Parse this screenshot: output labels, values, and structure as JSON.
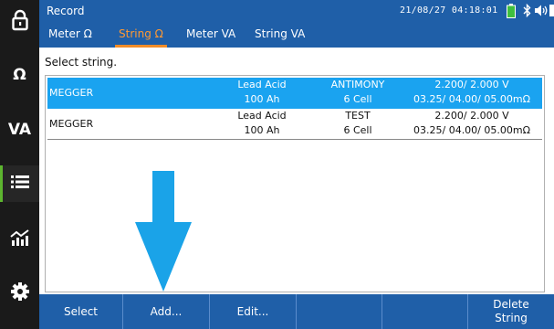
{
  "sidebar": {
    "items": [
      {
        "id": "lock",
        "icon": "lock-icon"
      },
      {
        "id": "ohm",
        "label": "Ω"
      },
      {
        "id": "va",
        "label": "VA"
      },
      {
        "id": "list",
        "icon": "list-icon",
        "active": true
      },
      {
        "id": "chart",
        "icon": "chart-icon"
      },
      {
        "id": "settings",
        "icon": "gear-icon"
      }
    ]
  },
  "header": {
    "title": "Record",
    "datetime": "21/08/27  04:18:01",
    "status_icons": [
      "battery-icon",
      "bluetooth-icon",
      "speaker-icon",
      "battery-level-icon"
    ]
  },
  "tabs": [
    {
      "label": "Meter Ω",
      "active": false
    },
    {
      "label": "String Ω",
      "active": true
    },
    {
      "label": "Meter VA",
      "active": false
    },
    {
      "label": "String VA",
      "active": false
    }
  ],
  "prompt": "Select string.",
  "strings": [
    {
      "name": "MEGGER",
      "type": "Lead Acid",
      "capacity": "100 Ah",
      "alloy": "ANTIMONY",
      "cells": "6 Cell",
      "voltage": "2.200/ 2.000 V",
      "resistance": "03.25/ 04.00/ 05.00mΩ",
      "selected": true
    },
    {
      "name": "MEGGER",
      "type": "Lead Acid",
      "capacity": "100 Ah",
      "alloy": "TEST",
      "cells": "6 Cell",
      "voltage": "2.200/ 2.000 V",
      "resistance": "03.25/ 04.00/ 05.00mΩ",
      "selected": false
    }
  ],
  "toolbar": {
    "select": "Select",
    "add": "Add...",
    "edit": "Edit...",
    "blank1": "",
    "blank2": "",
    "delete_line1": "Delete",
    "delete_line2": "String"
  },
  "colors": {
    "header_blue": "#1f5fa8",
    "selection_blue": "#1aa3f0",
    "active_tab_orange": "#f28c28",
    "sidebar_dark": "#1a1a1a",
    "active_indicator_green": "#5db52f",
    "arrow_cyan": "#1aa3e8"
  }
}
